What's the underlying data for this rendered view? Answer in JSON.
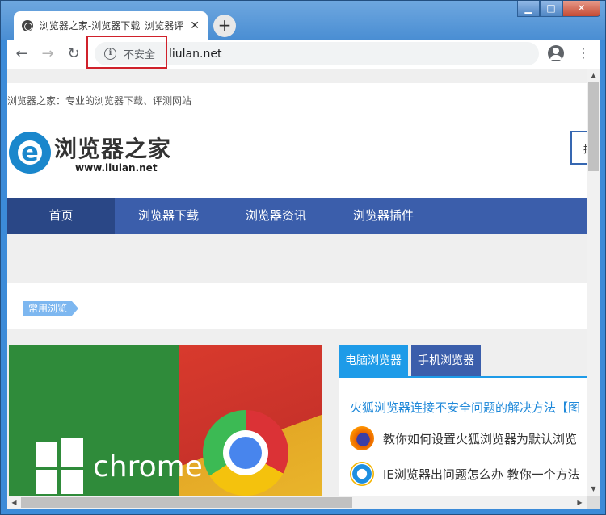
{
  "window": {
    "minimize": "▁",
    "maximize": "□",
    "close": "✕"
  },
  "tab": {
    "title": "浏览器之家-浏览器下载_浏览器评",
    "close": "✕",
    "new_tab": "+"
  },
  "toolbar": {
    "back": "←",
    "forward": "→",
    "reload": "↻",
    "security_icon": "i",
    "security_text": "不安全",
    "url": "liulan.net",
    "star": "☆",
    "menu": "⋮"
  },
  "site": {
    "slogan": "浏览器之家：专业的浏览器下载、评测网站",
    "logo_letter": "e",
    "logo_text": "浏览器之家",
    "logo_url": "www.liulan.net",
    "search_partial": "拍",
    "nav": [
      "首页",
      "浏览器下载",
      "浏览器资讯",
      "浏览器插件"
    ],
    "tag": "常用浏览",
    "banner_word": "chrome",
    "tabs": [
      "电脑浏览器",
      "手机浏览器"
    ],
    "lead": "火狐浏览器连接不安全问题的解决方法【图",
    "items": [
      {
        "icon": "firefox-icon",
        "text": "教你如何设置火狐浏览器为默认浏览"
      },
      {
        "icon": "ie-icon",
        "text": "IE浏览器出问题怎么办 教你一个方法"
      }
    ]
  },
  "scrollbars": {
    "up": "▲",
    "down": "▼",
    "left": "◀",
    "right": "▶"
  }
}
